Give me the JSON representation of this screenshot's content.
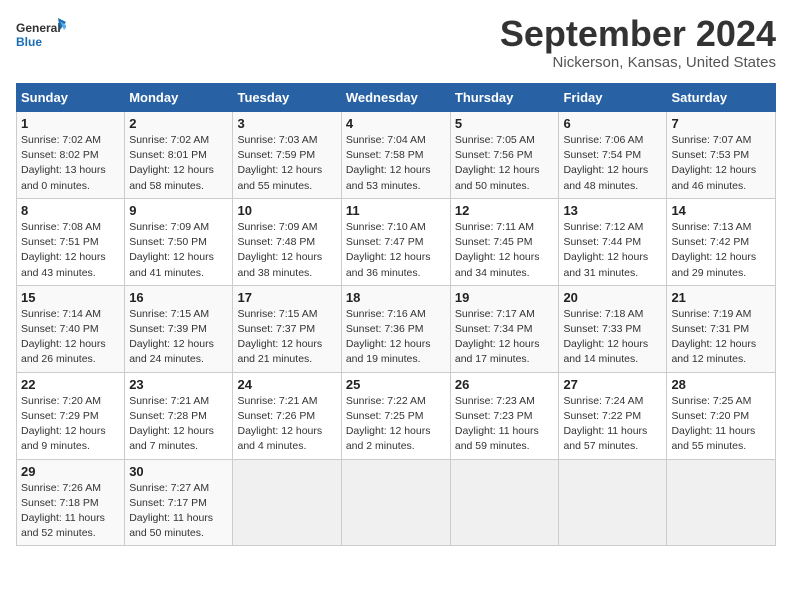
{
  "logo": {
    "line1": "General",
    "line2": "Blue"
  },
  "title": "September 2024",
  "location": "Nickerson, Kansas, United States",
  "headers": [
    "Sunday",
    "Monday",
    "Tuesday",
    "Wednesday",
    "Thursday",
    "Friday",
    "Saturday"
  ],
  "weeks": [
    [
      {
        "day": "1",
        "info": "Sunrise: 7:02 AM\nSunset: 8:02 PM\nDaylight: 13 hours\nand 0 minutes."
      },
      {
        "day": "2",
        "info": "Sunrise: 7:02 AM\nSunset: 8:01 PM\nDaylight: 12 hours\nand 58 minutes."
      },
      {
        "day": "3",
        "info": "Sunrise: 7:03 AM\nSunset: 7:59 PM\nDaylight: 12 hours\nand 55 minutes."
      },
      {
        "day": "4",
        "info": "Sunrise: 7:04 AM\nSunset: 7:58 PM\nDaylight: 12 hours\nand 53 minutes."
      },
      {
        "day": "5",
        "info": "Sunrise: 7:05 AM\nSunset: 7:56 PM\nDaylight: 12 hours\nand 50 minutes."
      },
      {
        "day": "6",
        "info": "Sunrise: 7:06 AM\nSunset: 7:54 PM\nDaylight: 12 hours\nand 48 minutes."
      },
      {
        "day": "7",
        "info": "Sunrise: 7:07 AM\nSunset: 7:53 PM\nDaylight: 12 hours\nand 46 minutes."
      }
    ],
    [
      {
        "day": "8",
        "info": "Sunrise: 7:08 AM\nSunset: 7:51 PM\nDaylight: 12 hours\nand 43 minutes."
      },
      {
        "day": "9",
        "info": "Sunrise: 7:09 AM\nSunset: 7:50 PM\nDaylight: 12 hours\nand 41 minutes."
      },
      {
        "day": "10",
        "info": "Sunrise: 7:09 AM\nSunset: 7:48 PM\nDaylight: 12 hours\nand 38 minutes."
      },
      {
        "day": "11",
        "info": "Sunrise: 7:10 AM\nSunset: 7:47 PM\nDaylight: 12 hours\nand 36 minutes."
      },
      {
        "day": "12",
        "info": "Sunrise: 7:11 AM\nSunset: 7:45 PM\nDaylight: 12 hours\nand 34 minutes."
      },
      {
        "day": "13",
        "info": "Sunrise: 7:12 AM\nSunset: 7:44 PM\nDaylight: 12 hours\nand 31 minutes."
      },
      {
        "day": "14",
        "info": "Sunrise: 7:13 AM\nSunset: 7:42 PM\nDaylight: 12 hours\nand 29 minutes."
      }
    ],
    [
      {
        "day": "15",
        "info": "Sunrise: 7:14 AM\nSunset: 7:40 PM\nDaylight: 12 hours\nand 26 minutes."
      },
      {
        "day": "16",
        "info": "Sunrise: 7:15 AM\nSunset: 7:39 PM\nDaylight: 12 hours\nand 24 minutes."
      },
      {
        "day": "17",
        "info": "Sunrise: 7:15 AM\nSunset: 7:37 PM\nDaylight: 12 hours\nand 21 minutes."
      },
      {
        "day": "18",
        "info": "Sunrise: 7:16 AM\nSunset: 7:36 PM\nDaylight: 12 hours\nand 19 minutes."
      },
      {
        "day": "19",
        "info": "Sunrise: 7:17 AM\nSunset: 7:34 PM\nDaylight: 12 hours\nand 17 minutes."
      },
      {
        "day": "20",
        "info": "Sunrise: 7:18 AM\nSunset: 7:33 PM\nDaylight: 12 hours\nand 14 minutes."
      },
      {
        "day": "21",
        "info": "Sunrise: 7:19 AM\nSunset: 7:31 PM\nDaylight: 12 hours\nand 12 minutes."
      }
    ],
    [
      {
        "day": "22",
        "info": "Sunrise: 7:20 AM\nSunset: 7:29 PM\nDaylight: 12 hours\nand 9 minutes."
      },
      {
        "day": "23",
        "info": "Sunrise: 7:21 AM\nSunset: 7:28 PM\nDaylight: 12 hours\nand 7 minutes."
      },
      {
        "day": "24",
        "info": "Sunrise: 7:21 AM\nSunset: 7:26 PM\nDaylight: 12 hours\nand 4 minutes."
      },
      {
        "day": "25",
        "info": "Sunrise: 7:22 AM\nSunset: 7:25 PM\nDaylight: 12 hours\nand 2 minutes."
      },
      {
        "day": "26",
        "info": "Sunrise: 7:23 AM\nSunset: 7:23 PM\nDaylight: 11 hours\nand 59 minutes."
      },
      {
        "day": "27",
        "info": "Sunrise: 7:24 AM\nSunset: 7:22 PM\nDaylight: 11 hours\nand 57 minutes."
      },
      {
        "day": "28",
        "info": "Sunrise: 7:25 AM\nSunset: 7:20 PM\nDaylight: 11 hours\nand 55 minutes."
      }
    ],
    [
      {
        "day": "29",
        "info": "Sunrise: 7:26 AM\nSunset: 7:18 PM\nDaylight: 11 hours\nand 52 minutes."
      },
      {
        "day": "30",
        "info": "Sunrise: 7:27 AM\nSunset: 7:17 PM\nDaylight: 11 hours\nand 50 minutes."
      },
      {
        "day": "",
        "info": ""
      },
      {
        "day": "",
        "info": ""
      },
      {
        "day": "",
        "info": ""
      },
      {
        "day": "",
        "info": ""
      },
      {
        "day": "",
        "info": ""
      }
    ]
  ]
}
